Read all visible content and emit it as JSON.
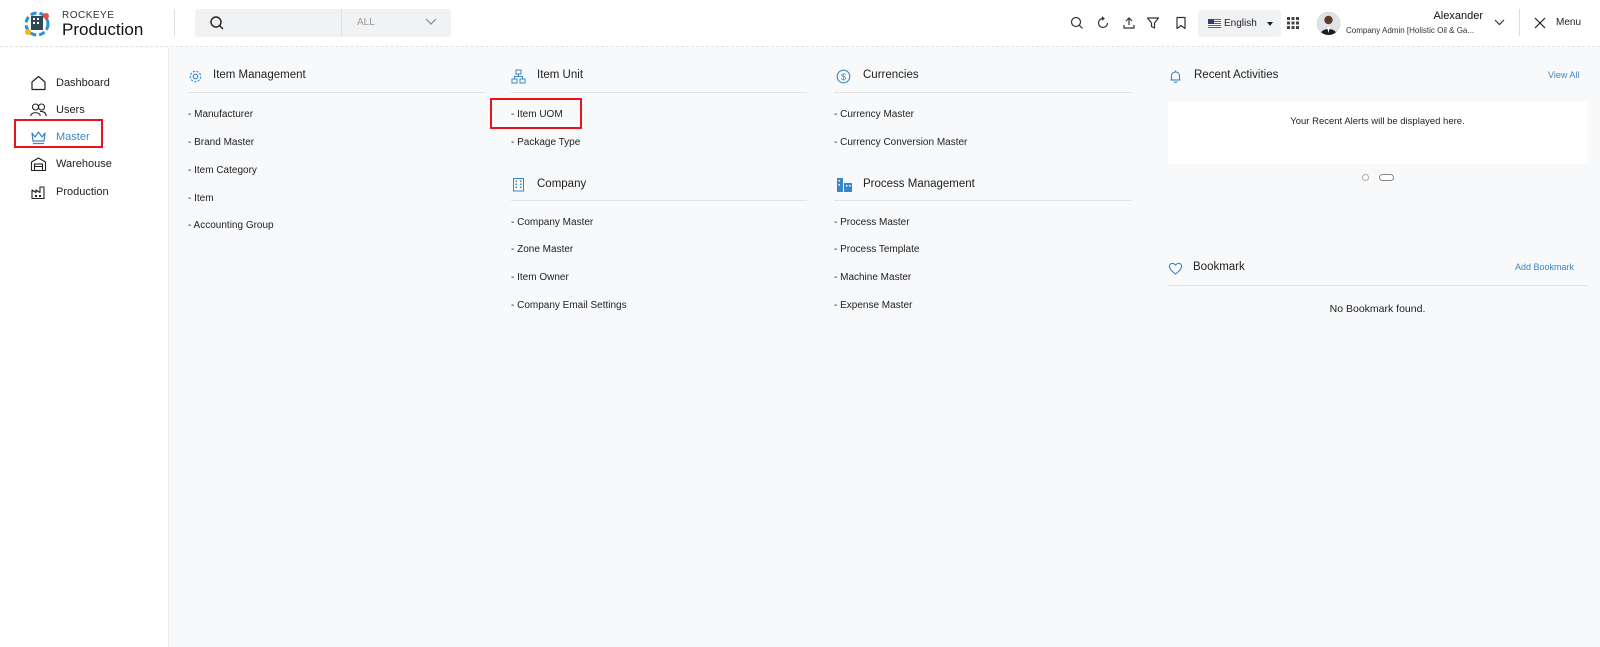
{
  "app": {
    "brand_top": "ROCKEYE",
    "brand_name": "Production"
  },
  "search": {
    "placeholder": "",
    "scope": "ALL"
  },
  "header": {
    "language": "English",
    "user_name": "Alexander",
    "user_role": "Company Admin [Holistic Oil & Ga...",
    "menu_label": "Menu",
    "toolbar_icons": [
      "search-icon",
      "refresh-icon",
      "upload-icon",
      "filter-icon",
      "bookmark-icon"
    ]
  },
  "sidebar": {
    "items": [
      {
        "label": "Dashboard",
        "icon": "home-icon"
      },
      {
        "label": "Users",
        "icon": "users-icon"
      },
      {
        "label": "Master",
        "icon": "crown-icon"
      },
      {
        "label": "Warehouse",
        "icon": "warehouse-icon"
      },
      {
        "label": "Production",
        "icon": "factory-icon"
      }
    ],
    "active": "Master"
  },
  "sections": {
    "item_management": {
      "title": "Item Management",
      "links": [
        "- Manufacturer",
        "- Brand Master",
        "- Item Category",
        "- Item",
        "- Accounting Group"
      ]
    },
    "item_unit": {
      "title": "Item Unit",
      "links": [
        "- Item UOM",
        "- Package Type"
      ]
    },
    "company": {
      "title": "Company",
      "links": [
        "- Company Master",
        "- Zone Master",
        "- Item Owner",
        "- Company Email Settings"
      ]
    },
    "currencies": {
      "title": "Currencies",
      "links": [
        "- Currency Master",
        "- Currency Conversion Master"
      ]
    },
    "process_management": {
      "title": "Process Management",
      "links": [
        "- Process Master",
        "- Process Template",
        "- Machine Master",
        "- Expense Master"
      ]
    }
  },
  "recent_activities": {
    "title": "Recent Activities",
    "view_all": "View All",
    "message": "Your Recent Alerts will be displayed here."
  },
  "bookmark": {
    "title": "Bookmark",
    "add_label": "Add Bookmark",
    "empty_message": "No Bookmark found."
  },
  "colors": {
    "accent": "#3a86c8",
    "highlight": "#e8141b"
  }
}
